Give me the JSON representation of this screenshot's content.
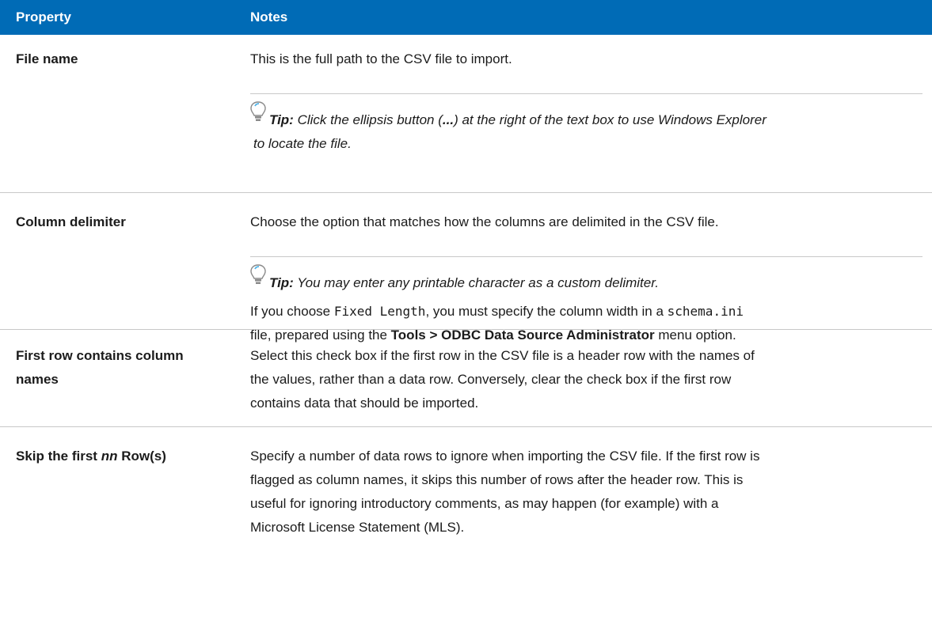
{
  "header": {
    "property": "Property",
    "notes": "Notes"
  },
  "rows": {
    "file_name": {
      "property": "File name",
      "note": "This is the full path to the CSV file to import.",
      "tip_label": "Tip:",
      "tip_part1": " Click the ellipsis button (",
      "tip_ellipsis": "...",
      "tip_part2": ") at the right of the text box to use Windows Explorer",
      "tip_line2": "to locate the file."
    },
    "column_delimiter": {
      "property": "Column delimiter",
      "note": "Choose the option that matches how the columns are delimited in the CSV file.",
      "tip_label": "Tip:",
      "tip_text": " You may enter any printable character as a custom delimiter.",
      "extra_1": "If you choose ",
      "extra_code1": "Fixed Length",
      "extra_2": ", you must specify the column width in a ",
      "extra_code2": "schema.ini",
      "extra_3": "file, prepared using the ",
      "extra_bold": "Tools > ODBC Data Source Administrator",
      "extra_4": " menu option."
    },
    "first_row": {
      "property_line1": "First row contains column",
      "property_line2": "names",
      "note_line1": "Select this check box if the first row in the CSV file is a header row with the names of",
      "note_line2": "the values, rather than a data row. Conversely, clear the check box if the first row",
      "note_line3": "contains data that should be imported."
    },
    "skip_rows": {
      "property_a": "Skip the first ",
      "property_em": "nn",
      "property_b": " Row(s)",
      "note_line1": "Specify a number of data rows to ignore when importing the CSV file. If the first row is",
      "note_line2": "flagged as column names, it skips this number of rows after the header row. This is",
      "note_line3": "useful for ignoring introductory comments, as may happen (for example) with a",
      "note_line4": "Microsoft License Statement (MLS)."
    }
  }
}
